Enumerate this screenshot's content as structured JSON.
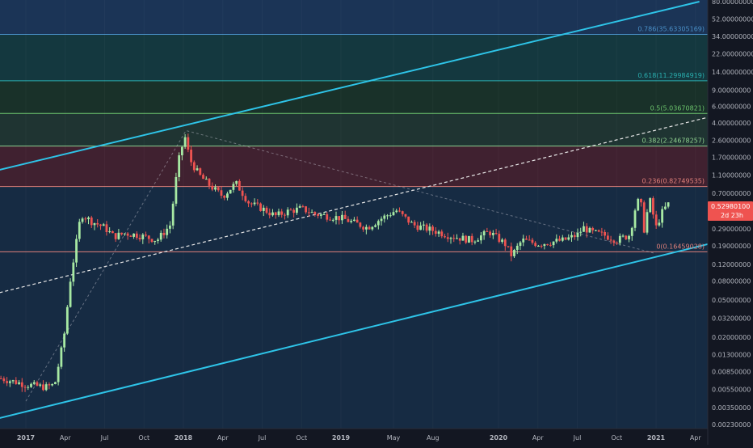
{
  "theme": {
    "background": "#131722",
    "axis_bg": "#131722",
    "axis_text": "#b2b5be",
    "grid": "#1e222d",
    "up_color": "#a7e9a3",
    "down_color": "#ef5350",
    "channel_color": "#2ec4e8",
    "price_tag_bg": "#ef5350"
  },
  "chart_data": {
    "type": "candlestick",
    "scale": "log",
    "ylim": [
      0.0019,
      80
    ],
    "y_ticks": [
      {
        "v": 80,
        "label": "80.00000000"
      },
      {
        "v": 52,
        "label": "52.00000000"
      },
      {
        "v": 34,
        "label": "34.00000000"
      },
      {
        "v": 22,
        "label": "22.00000000"
      },
      {
        "v": 14,
        "label": "14.00000000"
      },
      {
        "v": 9,
        "label": "9.00000000"
      },
      {
        "v": 6,
        "label": "6.00000000"
      },
      {
        "v": 4,
        "label": "4.00000000"
      },
      {
        "v": 2.6,
        "label": "2.60000000"
      },
      {
        "v": 1.7,
        "label": "1.70000000"
      },
      {
        "v": 1.1,
        "label": "1.10000000"
      },
      {
        "v": 0.7,
        "label": "0.70000000"
      },
      {
        "v": 0.45,
        "label": "0.4"
      },
      {
        "v": 0.29,
        "label": "0.29000000"
      },
      {
        "v": 0.19,
        "label": "0.19000000"
      },
      {
        "v": 0.12,
        "label": "0.12000000"
      },
      {
        "v": 0.08,
        "label": "0.08000000"
      },
      {
        "v": 0.05,
        "label": "0.05000000"
      },
      {
        "v": 0.032,
        "label": "0.03200000"
      },
      {
        "v": 0.02,
        "label": "0.02000000"
      },
      {
        "v": 0.013,
        "label": "0.01300000"
      },
      {
        "v": 0.0085,
        "label": "0.00850000"
      },
      {
        "v": 0.0055,
        "label": "0.00550000"
      },
      {
        "v": 0.0035,
        "label": "0.00350000"
      },
      {
        "v": 0.0023,
        "label": "0.00230000"
      }
    ],
    "x_ticks": [
      {
        "t": 0,
        "label": "2017",
        "bold": true
      },
      {
        "t": 3,
        "label": "Apr"
      },
      {
        "t": 6,
        "label": "Jul"
      },
      {
        "t": 9,
        "label": "Oct"
      },
      {
        "t": 12,
        "label": "2018",
        "bold": true
      },
      {
        "t": 15,
        "label": "Apr"
      },
      {
        "t": 18,
        "label": "Jul"
      },
      {
        "t": 21,
        "label": "Oct"
      },
      {
        "t": 24,
        "label": "2019",
        "bold": true
      },
      {
        "t": 28,
        "label": "May"
      },
      {
        "t": 31,
        "label": "Aug"
      },
      {
        "t": 36,
        "label": "2020",
        "bold": true
      },
      {
        "t": 39,
        "label": "Apr"
      },
      {
        "t": 42,
        "label": "Jul"
      },
      {
        "t": 45,
        "label": "Oct"
      },
      {
        "t": 48,
        "label": "2021",
        "bold": true
      },
      {
        "t": 51,
        "label": "Apr"
      }
    ],
    "fib_levels": [
      {
        "ratio": "0.786",
        "value": 35.63305169,
        "label": "0.786(35.63305169)",
        "color": "#4a90c8",
        "fill": "rgba(41,98,165,0.40)"
      },
      {
        "ratio": "0.618",
        "value": 11.29984919,
        "label": "0.618(11.29984919)",
        "color": "#2ab0b0",
        "fill": "rgba(24,110,110,0.38)"
      },
      {
        "ratio": "0.5",
        "value": 5.03670821,
        "label": "0.5(5.03670821)",
        "color": "#6cc46c",
        "fill": "rgba(40,110,60,0.30)"
      },
      {
        "ratio": "0.382",
        "value": 2.24678257,
        "label": "0.382(2.24678257)",
        "color": "#8fd08f",
        "fill": "rgba(60,120,90,0.30)"
      },
      {
        "ratio": "0.236",
        "value": 0.82749535,
        "label": "0.236(0.82749535)",
        "color": "#e0807a",
        "fill": "rgba(140,50,70,0.38)"
      },
      {
        "ratio": "0",
        "value": 0.16459028,
        "label": "0(0.16459028)",
        "color": "#e0807a",
        "fill": "rgba(30,80,130,0.35)"
      }
    ],
    "current_price": {
      "label": "0.52980100",
      "countdown": "2d 23h",
      "value": 0.5298
    }
  }
}
